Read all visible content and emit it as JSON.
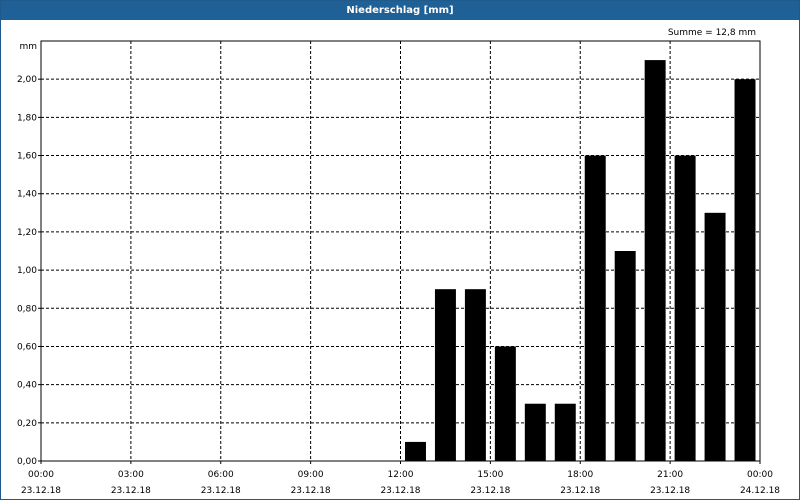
{
  "window": {
    "title": "Niederschlag [mm]"
  },
  "chart_data": {
    "type": "bar",
    "title": "Niederschlag [mm]",
    "ylabel": "mm",
    "annotation": "Summe = 12,8 mm",
    "ylim": [
      0,
      2.2
    ],
    "y_ticks": [
      {
        "value": 0.0,
        "label": "0,00"
      },
      {
        "value": 0.2,
        "label": "0,20"
      },
      {
        "value": 0.4,
        "label": "0,40"
      },
      {
        "value": 0.6,
        "label": "0,60"
      },
      {
        "value": 0.8,
        "label": "0,80"
      },
      {
        "value": 1.0,
        "label": "1,00"
      },
      {
        "value": 1.2,
        "label": "1,20"
      },
      {
        "value": 1.4,
        "label": "1,40"
      },
      {
        "value": 1.6,
        "label": "1,60"
      },
      {
        "value": 1.8,
        "label": "1,80"
      },
      {
        "value": 2.0,
        "label": "2,00"
      }
    ],
    "x_range_hours": [
      0,
      24
    ],
    "x_ticks": [
      {
        "hour": 0,
        "time": "00:00",
        "date": "23.12.18"
      },
      {
        "hour": 3,
        "time": "03:00",
        "date": "23.12.18"
      },
      {
        "hour": 6,
        "time": "06:00",
        "date": "23.12.18"
      },
      {
        "hour": 9,
        "time": "09:00",
        "date": "23.12.18"
      },
      {
        "hour": 12,
        "time": "12:00",
        "date": "23.12.18"
      },
      {
        "hour": 15,
        "time": "15:00",
        "date": "23.12.18"
      },
      {
        "hour": 18,
        "time": "18:00",
        "date": "23.12.18"
      },
      {
        "hour": 21,
        "time": "21:00",
        "date": "23.12.18"
      },
      {
        "hour": 24,
        "time": "00:00",
        "date": "24.12.18"
      }
    ],
    "bars": [
      {
        "hour": 13,
        "value": 0.1
      },
      {
        "hour": 14,
        "value": 0.9
      },
      {
        "hour": 15,
        "value": 0.9
      },
      {
        "hour": 16,
        "value": 0.6
      },
      {
        "hour": 17,
        "value": 0.3
      },
      {
        "hour": 18,
        "value": 0.3
      },
      {
        "hour": 19,
        "value": 1.6
      },
      {
        "hour": 20,
        "value": 1.1
      },
      {
        "hour": 21,
        "value": 2.1
      },
      {
        "hour": 22,
        "value": 1.6
      },
      {
        "hour": 23,
        "value": 1.3
      },
      {
        "hour": 24,
        "value": 2.0
      }
    ],
    "grid": true,
    "bar_color": "#000000",
    "title_bar_color": "#1f6097"
  }
}
